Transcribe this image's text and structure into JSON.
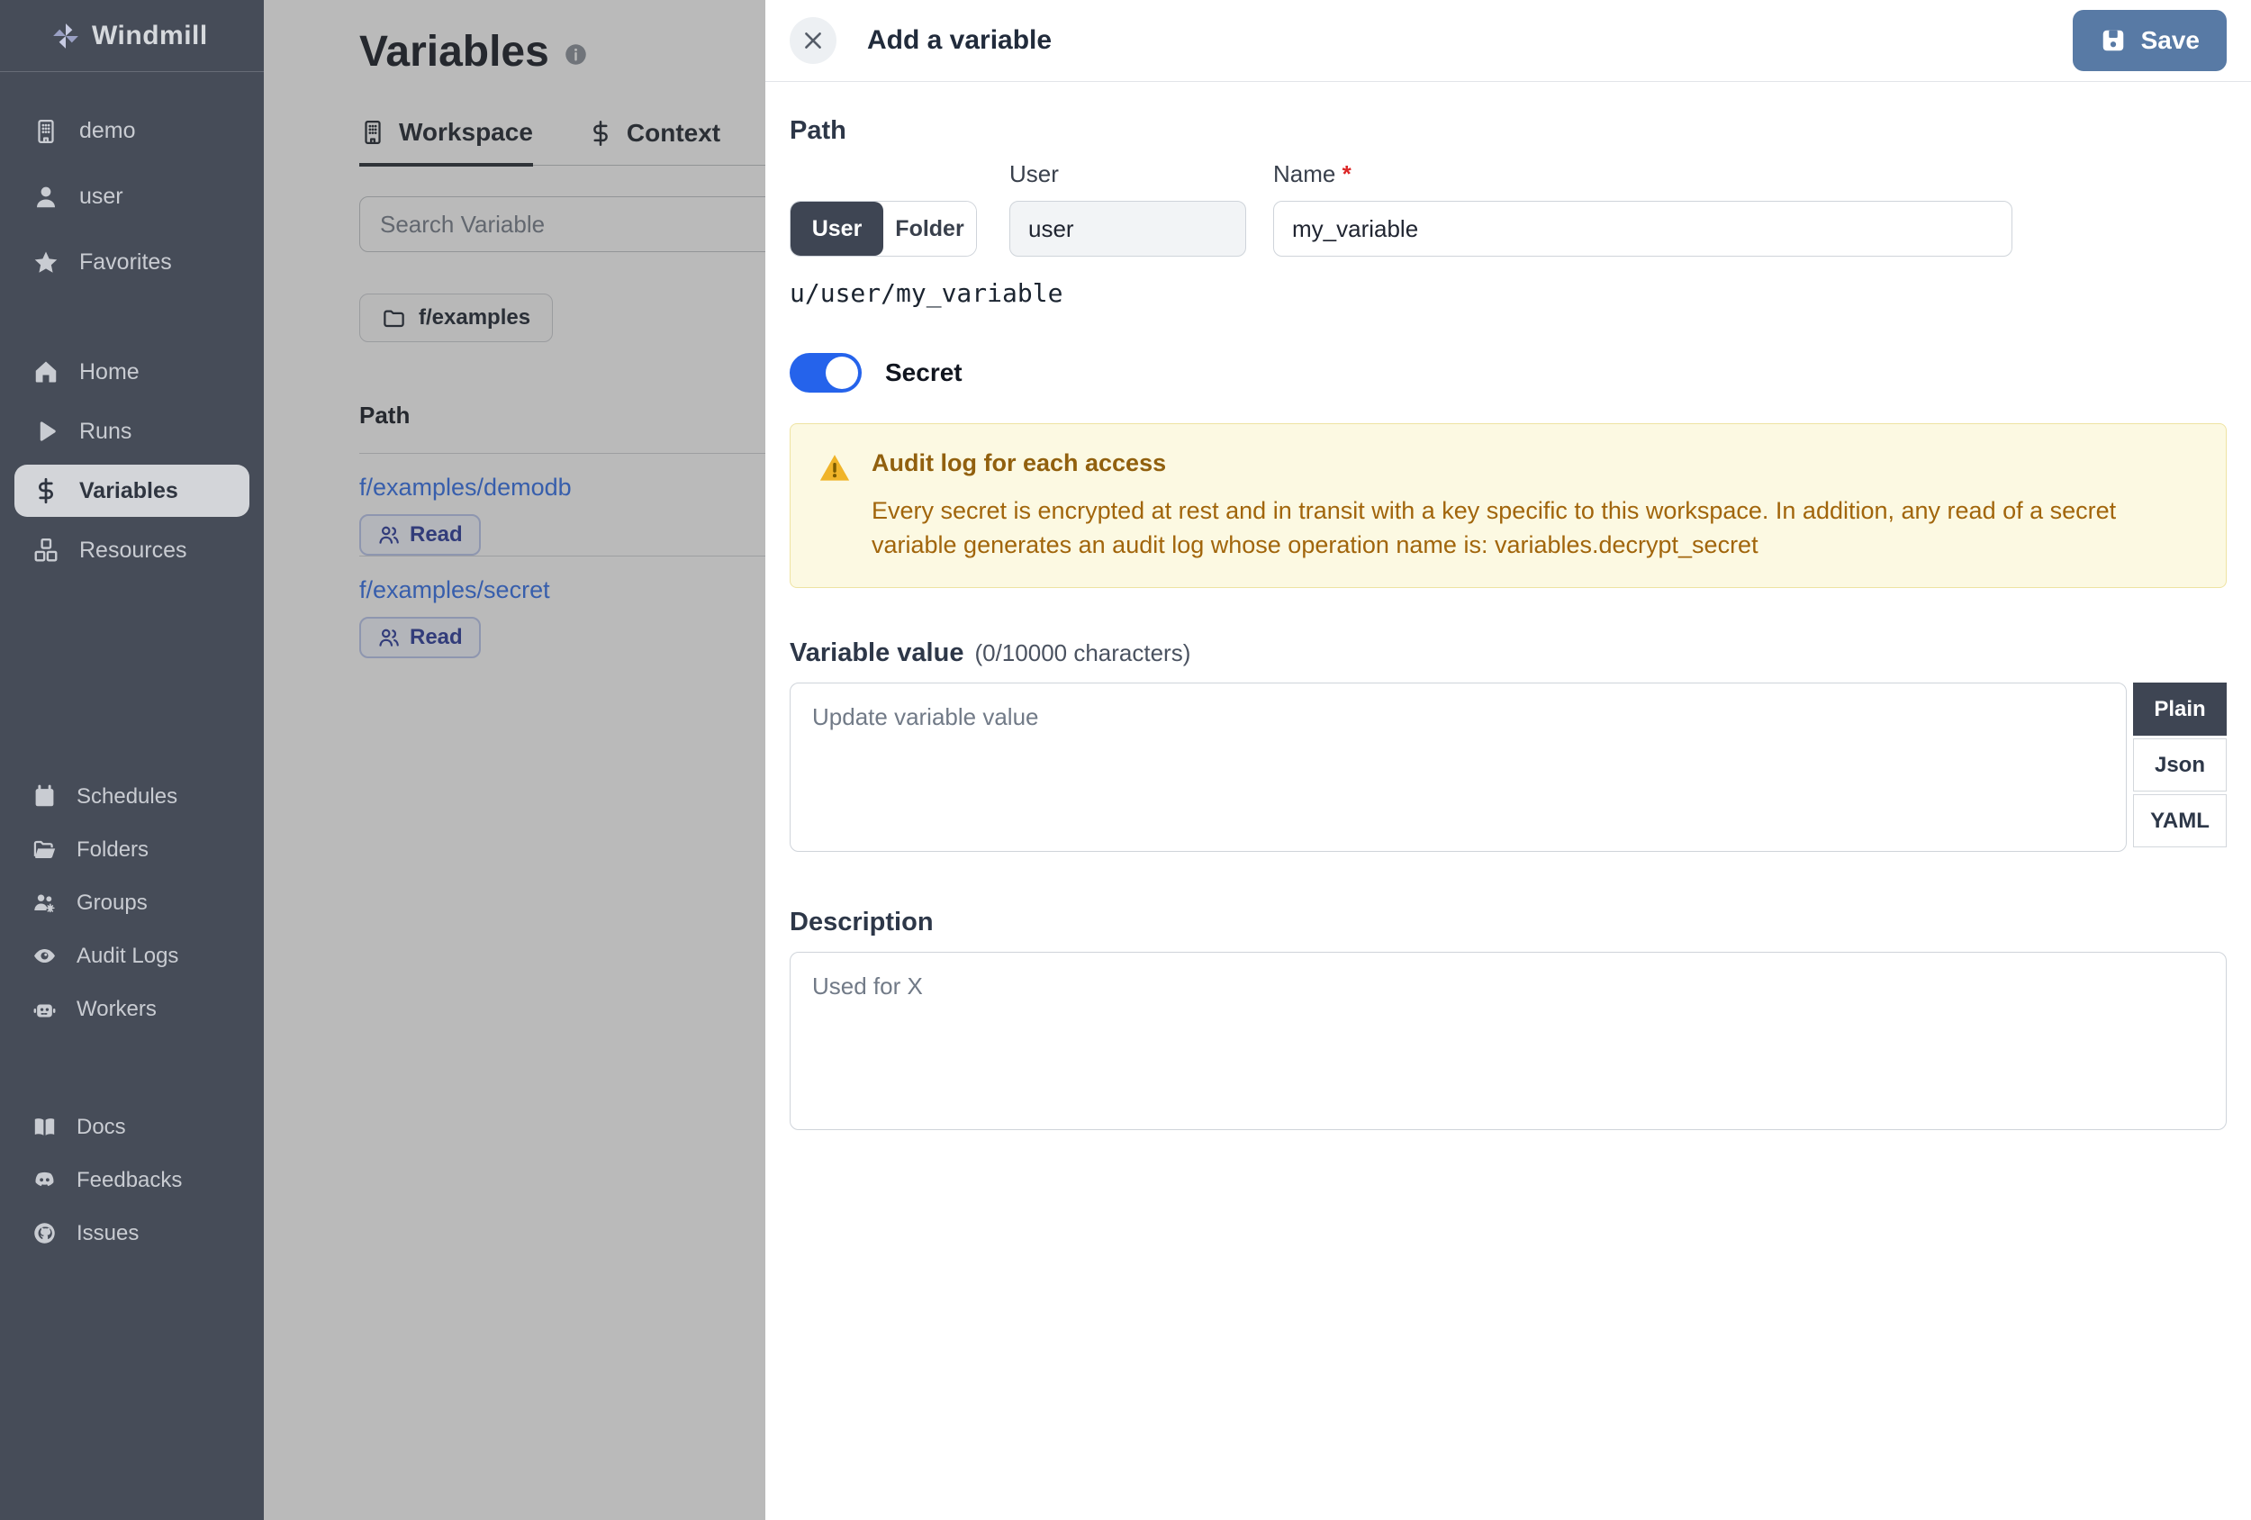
{
  "sidebar": {
    "logo": "Windmill",
    "workspace_items": [
      {
        "icon": "building-icon",
        "label": "demo"
      },
      {
        "icon": "user-icon",
        "label": "user"
      },
      {
        "icon": "star-icon",
        "label": "Favorites"
      }
    ],
    "nav_items": [
      {
        "icon": "home-icon",
        "label": "Home",
        "active": false
      },
      {
        "icon": "play-icon",
        "label": "Runs",
        "active": false
      },
      {
        "icon": "dollar-icon",
        "label": "Variables",
        "active": true
      },
      {
        "icon": "boxes-icon",
        "label": "Resources",
        "active": false
      }
    ],
    "secondary_items": [
      {
        "icon": "calendar-icon",
        "label": "Schedules"
      },
      {
        "icon": "folder-open-icon",
        "label": "Folders"
      },
      {
        "icon": "users-gear-icon",
        "label": "Groups"
      },
      {
        "icon": "eye-icon",
        "label": "Audit Logs"
      },
      {
        "icon": "robot-icon",
        "label": "Workers"
      }
    ],
    "footer_items": [
      {
        "icon": "book-icon",
        "label": "Docs"
      },
      {
        "icon": "discord-icon",
        "label": "Feedbacks"
      },
      {
        "icon": "github-icon",
        "label": "Issues"
      }
    ]
  },
  "main": {
    "title": "Variables",
    "tabs": [
      {
        "label": "Workspace",
        "active": true
      },
      {
        "label": "Context",
        "active": false
      }
    ],
    "search_placeholder": "Search Variable",
    "folder_chip": "f/examples",
    "table": {
      "path_header": "Path",
      "rows": [
        {
          "path": "f/examples/demodb",
          "badge": "Read"
        },
        {
          "path": "f/examples/secret",
          "badge": "Read"
        }
      ]
    }
  },
  "drawer": {
    "title": "Add a variable",
    "save_label": "Save",
    "path_section": {
      "heading": "Path",
      "owner_kind_options": [
        "User",
        "Folder"
      ],
      "selected_owner_kind": "User",
      "user_label": "User",
      "user_value": "user",
      "name_label": "Name",
      "required_mark": "*",
      "name_value": "my_variable",
      "full_path": "u/user/my_variable"
    },
    "secret_toggle": {
      "label": "Secret",
      "on": true
    },
    "warning": {
      "title": "Audit log for each access",
      "body": "Every secret is encrypted at rest and in transit with a key specific to this workspace. In addition, any read of a secret variable generates an audit log whose operation name is: variables.decrypt_secret"
    },
    "value_section": {
      "heading": "Variable value",
      "counter": "(0/10000 characters)",
      "placeholder": "Update variable value",
      "formats": [
        "Plain",
        "Json",
        "YAML"
      ],
      "selected_format": "Plain"
    },
    "description_section": {
      "heading": "Description",
      "placeholder": "Used for X"
    }
  },
  "colors": {
    "sidebar_bg": "#464c58",
    "selected_pill": "#d3d5d9",
    "accent_toggle_blue": "#2563eb",
    "save_button_blue": "#587aa5",
    "link_blue": "#4c82ec",
    "warning_bg": "#fcf9e2",
    "warning_text": "#a1650b",
    "selected_segment": "#3e4553",
    "required_red": "#dc2626"
  }
}
